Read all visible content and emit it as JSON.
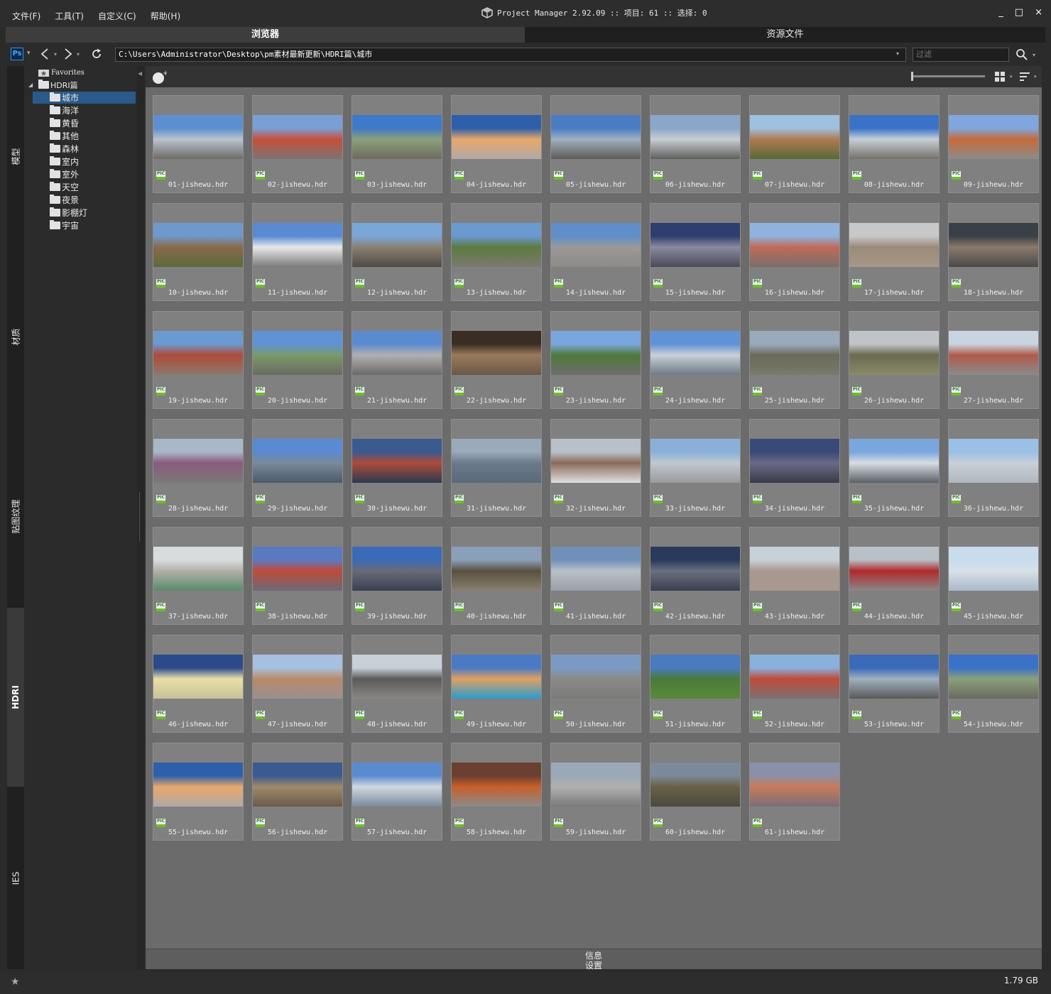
{
  "menu": [
    "文件(F)",
    "工具(T)",
    "自定义(C)",
    "帮助(H)"
  ],
  "app_title": "Project Manager 2.92.09  :: 项目: 61  :: 选择: 0",
  "tabs": {
    "browser": "浏览器",
    "assets": "资源文件"
  },
  "address": {
    "ps_label": "Ps",
    "path": "C:\\Users\\Administrator\\Desktop\\pm素材最新更新\\HDRI篇\\城市",
    "filter_placeholder": "过滤"
  },
  "side_tabs": [
    "模型",
    "材质",
    "贴图纹理",
    "HDRI",
    "IES"
  ],
  "tree": {
    "favorites": "Favorites",
    "root": "HDRI篇",
    "children": [
      "城市",
      "海洋",
      "黄昏",
      "其他",
      "森林",
      "室内",
      "室外",
      "天空",
      "夜景",
      "影棚灯",
      "宇宙"
    ],
    "selected": "城市"
  },
  "badge_label": "PIC",
  "files": [
    "01-jishewu.hdr",
    "02-jishewu.hdr",
    "03-jishewu.hdr",
    "04-jishewu.hdr",
    "05-jishewu.hdr",
    "06-jishewu.hdr",
    "07-jishewu.hdr",
    "08-jishewu.hdr",
    "09-jishewu.hdr",
    "10-jishewu.hdr",
    "11-jishewu.hdr",
    "12-jishewu.hdr",
    "13-jishewu.hdr",
    "14-jishewu.hdr",
    "15-jishewu.hdr",
    "16-jishewu.hdr",
    "17-jishewu.hdr",
    "18-jishewu.hdr",
    "19-jishewu.hdr",
    "20-jishewu.hdr",
    "21-jishewu.hdr",
    "22-jishewu.hdr",
    "23-jishewu.hdr",
    "24-jishewu.hdr",
    "25-jishewu.hdr",
    "26-jishewu.hdr",
    "27-jishewu.hdr",
    "28-jishewu.hdr",
    "29-jishewu.hdr",
    "30-jishewu.hdr",
    "31-jishewu.hdr",
    "32-jishewu.hdr",
    "33-jishewu.hdr",
    "34-jishewu.hdr",
    "35-jishewu.hdr",
    "36-jishewu.hdr",
    "37-jishewu.hdr",
    "38-jishewu.hdr",
    "39-jishewu.hdr",
    "40-jishewu.hdr",
    "41-jishewu.hdr",
    "42-jishewu.hdr",
    "43-jishewu.hdr",
    "44-jishewu.hdr",
    "45-jishewu.hdr",
    "46-jishewu.hdr",
    "47-jishewu.hdr",
    "48-jishewu.hdr",
    "49-jishewu.hdr",
    "50-jishewu.hdr",
    "51-jishewu.hdr",
    "52-jishewu.hdr",
    "53-jishewu.hdr",
    "54-jishewu.hdr",
    "55-jishewu.hdr",
    "56-jishewu.hdr",
    "57-jishewu.hdr",
    "58-jishewu.hdr",
    "59-jishewu.hdr",
    "60-jishewu.hdr",
    "61-jishewu.hdr"
  ],
  "thumb_palettes": [
    [
      "#5d8fd0",
      "#b9c3cc",
      "#6e6b68"
    ],
    [
      "#7a9fd4",
      "#c5503a",
      "#7d7370"
    ],
    [
      "#3f79c9",
      "#8aa07a",
      "#6c6a60"
    ],
    [
      "#2d5faa",
      "#e8a86a",
      "#b0a8a8"
    ],
    [
      "#4a7cc4",
      "#9fb0c0",
      "#5f5a58"
    ],
    [
      "#8aa6c9",
      "#c9cdd2",
      "#5e605d"
    ],
    [
      "#9fc0de",
      "#b07a52",
      "#566a38"
    ],
    [
      "#3a72c8",
      "#c6cfd6",
      "#77706a"
    ],
    [
      "#7fa7de",
      "#c76a3a",
      "#8c8b8a"
    ],
    [
      "#6f98cc",
      "#8a6a4a",
      "#5a6b3a"
    ],
    [
      "#5a8ad2",
      "#e8e8e8",
      "#7b7b7b"
    ],
    [
      "#7aa6d8",
      "#8a8070",
      "#4f4a45"
    ],
    [
      "#6a9ad0",
      "#5c7a40",
      "#7d7a70"
    ],
    [
      "#5f8ec8",
      "#9a9a9a",
      "#8e8a86"
    ],
    [
      "#2e3e6e",
      "#8a8aa0",
      "#4a4a58"
    ],
    [
      "#8fb2de",
      "#c06a5a",
      "#7a6e68"
    ],
    [
      "#c8c8c8",
      "#9a8a7a",
      "#a89888"
    ],
    [
      "#3a4048",
      "#8a7a6a",
      "#4a4a4a"
    ],
    [
      "#6a9ad0",
      "#b04a3a",
      "#8a7a6a"
    ],
    [
      "#5f93d6",
      "#7a9a6a",
      "#6a6a60"
    ],
    [
      "#5a8ad0",
      "#b0b0b0",
      "#6c6a68"
    ],
    [
      "#3a2e24",
      "#9a7a5a",
      "#6a5848"
    ],
    [
      "#7aa6de",
      "#4e7a3a",
      "#6e6e6e"
    ],
    [
      "#5f93d6",
      "#c8d0d8",
      "#6e7a86"
    ],
    [
      "#9aaabb",
      "#6a6a5a",
      "#7a7a6a"
    ],
    [
      "#c0c4c8",
      "#6a6a50",
      "#8a8a6a"
    ],
    [
      "#c8d4e0",
      "#b05a4a",
      "#8a8a8a"
    ],
    [
      "#a8b8c8",
      "#8a5a7a",
      "#7a7a7a"
    ],
    [
      "#5a8ad2",
      "#7a8a9a",
      "#4a5a6a"
    ],
    [
      "#3a5a90",
      "#b04a3a",
      "#2a3a50"
    ],
    [
      "#9aaabb",
      "#6a7a8a",
      "#5a6a7a"
    ],
    [
      "#b8c0c8",
      "#8a6a5a",
      "#e0e0e0"
    ],
    [
      "#8ab0da",
      "#c0c8d0",
      "#9a9a9a"
    ],
    [
      "#3a4a78",
      "#6a6a88",
      "#3a3a48"
    ],
    [
      "#7aa6de",
      "#d8dde2",
      "#5a6068"
    ],
    [
      "#9ac0e6",
      "#c8d0d8",
      "#b0b6bc"
    ],
    [
      "#d8dcdc",
      "#b0b0a8",
      "#5a8a6a"
    ],
    [
      "#5a7ac0",
      "#c04a3a",
      "#6a6a7a"
    ],
    [
      "#3a6ab8",
      "#6a6a78",
      "#3a4050"
    ],
    [
      "#8aa0b8",
      "#5a5040",
      "#8a8070"
    ],
    [
      "#7090b8",
      "#b8c0c8",
      "#9aa0a8"
    ],
    [
      "#2a3a5a",
      "#6a7080",
      "#3a4050"
    ],
    [
      "#c8d0d8",
      "#a89890",
      "#a89890"
    ],
    [
      "#b8c0c8",
      "#b02a2a",
      "#8a8888"
    ],
    [
      "#c8dcee",
      "#d8e0e8",
      "#a8b8c8"
    ],
    [
      "#2a4a8a",
      "#e8e0a8",
      "#c8c098"
    ],
    [
      "#a8c0e0",
      "#b88a6a",
      "#9a9090"
    ],
    [
      "#c8d0d8",
      "#5a5a58",
      "#8a8684"
    ],
    [
      "#4a7ac4",
      "#e0a060",
      "#2a9ad0"
    ],
    [
      "#7a9ac4",
      "#8a8a88",
      "#7a7a78"
    ],
    [
      "#4a7ac0",
      "#4a7a3a",
      "#5a8a3a"
    ],
    [
      "#8ab0de",
      "#c04a3a",
      "#7a7070"
    ],
    [
      "#3a6ab8",
      "#a0b0c0",
      "#5a5a58"
    ],
    [
      "#3a72c8",
      "#8aa07a",
      "#6a6a60"
    ],
    [
      "#2d5faa",
      "#e8a86a",
      "#b0a8a8"
    ],
    [
      "#3a5a90",
      "#a08a6a",
      "#6a5a4a"
    ],
    [
      "#5a8ad0",
      "#d0d8e0",
      "#7a8a9a"
    ],
    [
      "#6a4030",
      "#c8602a",
      "#8a8a8a"
    ],
    [
      "#9aa8b8",
      "#b0b0b0",
      "#7a7a7a"
    ],
    [
      "#7a8a9a",
      "#6a6048",
      "#4a4a40"
    ],
    [
      "#8a90a8",
      "#c87a5a",
      "#7a6e78"
    ]
  ],
  "bottom": {
    "info": "信息",
    "settings": "设置"
  },
  "status": {
    "disk": "1.79 GB"
  },
  "window_buttons": [
    "_",
    "□",
    "×"
  ]
}
